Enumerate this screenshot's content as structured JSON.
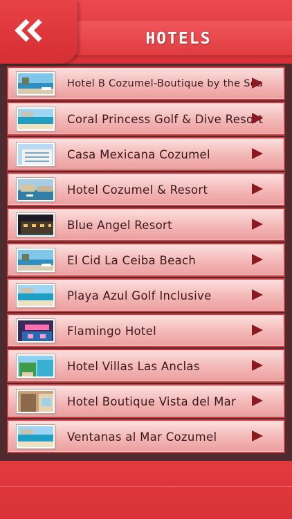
{
  "header": {
    "title": "HOTELS",
    "back_icon": "double-chevron-left-icon"
  },
  "hotels": [
    {
      "name": "Hotel B Cozumel-Boutique by the Sea",
      "thumb": "pool-lounge"
    },
    {
      "name": "Coral Princess Golf & Dive Resort",
      "thumb": "beach"
    },
    {
      "name": "Casa Mexicana Cozumel",
      "thumb": "building"
    },
    {
      "name": "Hotel Cozumel & Resort",
      "thumb": "harbor"
    },
    {
      "name": "Blue Angel Resort",
      "thumb": "night"
    },
    {
      "name": "El Cid La Ceiba Beach",
      "thumb": "pool-lounge"
    },
    {
      "name": "Playa Azul Golf Inclusive",
      "thumb": "beach"
    },
    {
      "name": "Flamingo Hotel",
      "thumb": "neon"
    },
    {
      "name": "Hotel Villas Las Anclas",
      "thumb": "tropical"
    },
    {
      "name": "Hotel Boutique Vista del Mar",
      "thumb": "balcony"
    },
    {
      "name": "Ventanas al Mar Cozumel",
      "thumb": "beach"
    }
  ],
  "colors": {
    "header_red": "#e23a3e",
    "list_frame": "#4d2b2e",
    "arrow": "#8a1a20",
    "row_text": "#3a1a1c"
  }
}
